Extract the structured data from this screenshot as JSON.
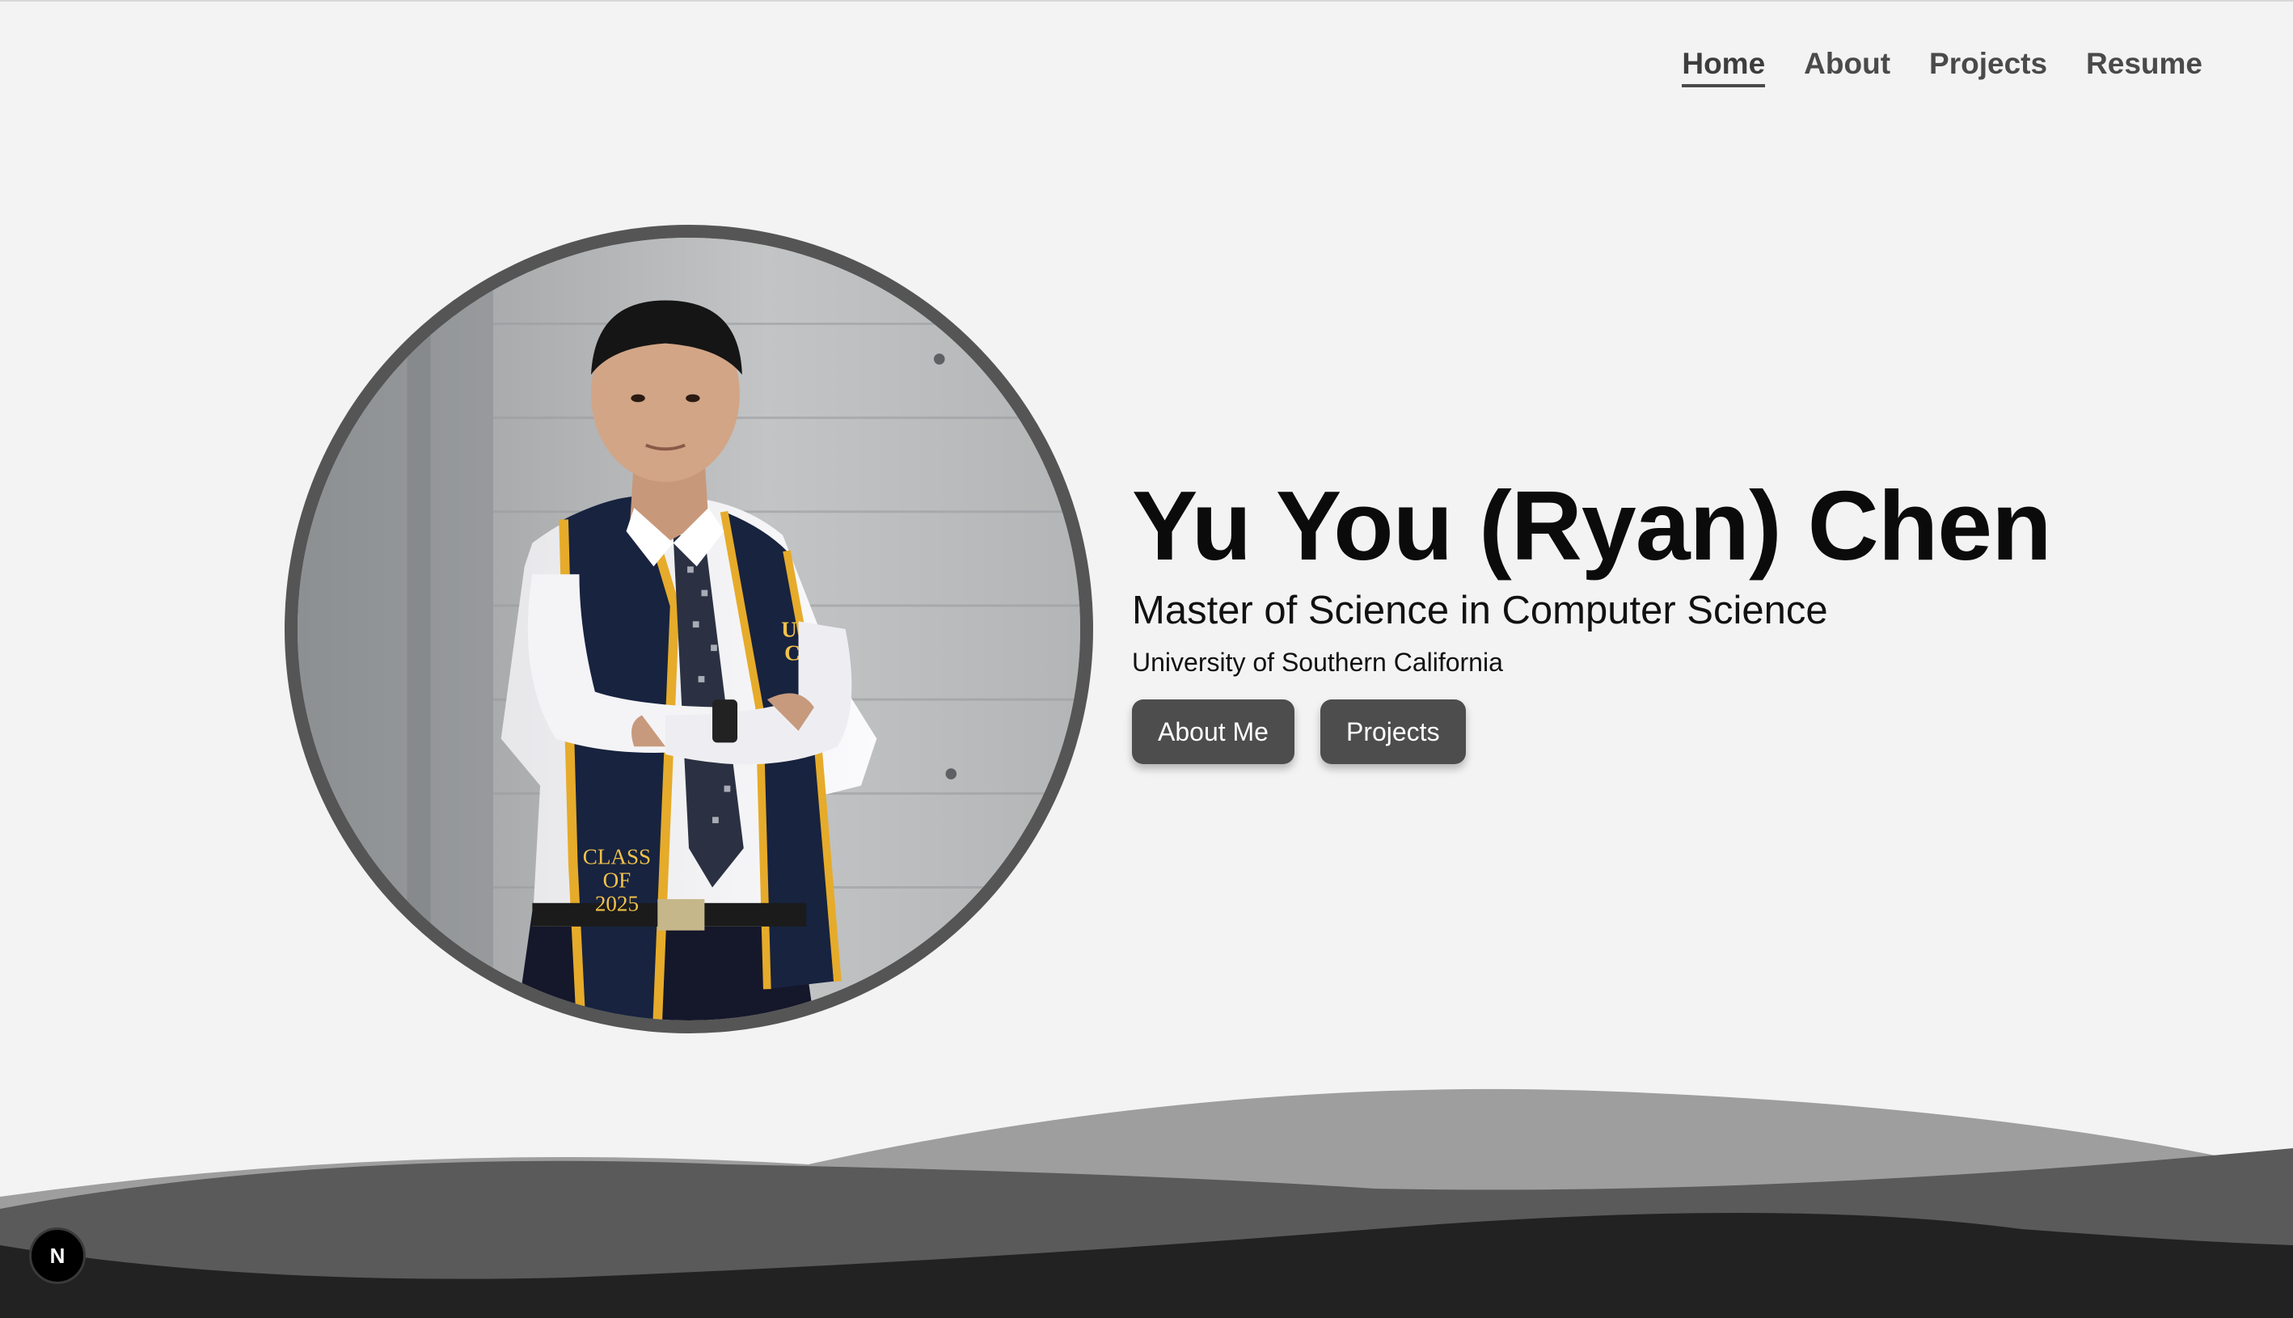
{
  "nav": {
    "items": [
      {
        "label": "Home",
        "active": true
      },
      {
        "label": "About",
        "active": false
      },
      {
        "label": "Projects",
        "active": false
      },
      {
        "label": "Resume",
        "active": false
      }
    ]
  },
  "hero": {
    "name": "Yu You (Ryan) Chen",
    "degree": "Master of Science in Computer Science",
    "school": "University of Southern California",
    "buttons": {
      "about_label": "About Me",
      "projects_label": "Projects"
    }
  },
  "portrait": {
    "stole_text": [
      "CLASS",
      "OF",
      "2025"
    ],
    "stole_letters": "UC"
  },
  "badge": {
    "letter": "N"
  },
  "colors": {
    "background": "#f3f3f3",
    "button": "#4d4d4d",
    "wave_light": "#9e9e9e",
    "wave_mid": "#5a5a5a",
    "wave_dark": "#222222"
  }
}
